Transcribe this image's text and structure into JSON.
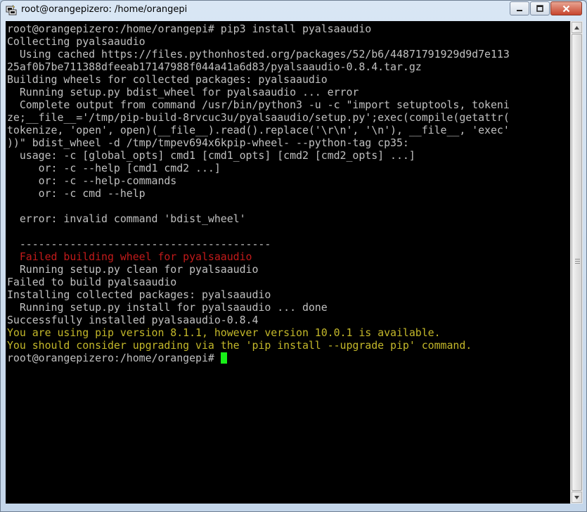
{
  "window": {
    "title": "root@orangepizero: /home/orangepi",
    "icon": "putty-terminal-icon",
    "controls": {
      "minimize": "minimize-icon",
      "maximize": "maximize-icon",
      "close": "close-icon"
    }
  },
  "terminal": {
    "lines": [
      "root@orangepizero:/home/orangepi# pip3 install pyalsaaudio",
      "Collecting pyalsaaudio",
      "  Using cached https://files.pythonhosted.org/packages/52/b6/44871791929d9d7e113",
      "25af0b7be711388dfeeab17147988f044a41a6d83/pyalsaaudio-0.8.4.tar.gz",
      "Building wheels for collected packages: pyalsaaudio",
      "  Running setup.py bdist_wheel for pyalsaaudio ... error",
      "  Complete output from command /usr/bin/python3 -u -c \"import setuptools, tokeni",
      "ze;__file__='/tmp/pip-build-8rvcuc3u/pyalsaaudio/setup.py';exec(compile(getattr(",
      "tokenize, 'open', open)(__file__).read().replace('\\r\\n', '\\n'), __file__, 'exec'",
      "))\" bdist_wheel -d /tmp/tmpev694x6kpip-wheel- --python-tag cp35:",
      "  usage: -c [global_opts] cmd1 [cmd1_opts] [cmd2 [cmd2_opts] ...]",
      "     or: -c --help [cmd1 cmd2 ...]",
      "     or: -c --help-commands",
      "     or: -c cmd --help",
      "",
      "  error: invalid command 'bdist_wheel'",
      "",
      "  ----------------------------------------",
      "  Failed building wheel for pyalsaaudio",
      "  Running setup.py clean for pyalsaaudio",
      "Failed to build pyalsaaudio",
      "Installing collected packages: pyalsaaudio",
      "  Running setup.py install for pyalsaaudio ... done",
      "Successfully installed pyalsaaudio-0.8.4",
      "You are using pip version 8.1.1, however version 10.0.1 is available.",
      "You should consider upgrading via the 'pip install --upgrade pip' command.",
      "root@orangepizero:/home/orangepi# "
    ],
    "line_colors": [
      "default",
      "default",
      "default",
      "default",
      "default",
      "default",
      "default",
      "default",
      "default",
      "default",
      "default",
      "default",
      "default",
      "default",
      "default",
      "default",
      "default",
      "default",
      "red",
      "default",
      "default",
      "default",
      "default",
      "default",
      "yellow",
      "yellow",
      "default"
    ],
    "colors": {
      "background": "#000000",
      "text": "#c0c0c0",
      "error": "#c21a1a",
      "warning": "#c4b82a",
      "cursor": "#18ef18"
    }
  }
}
